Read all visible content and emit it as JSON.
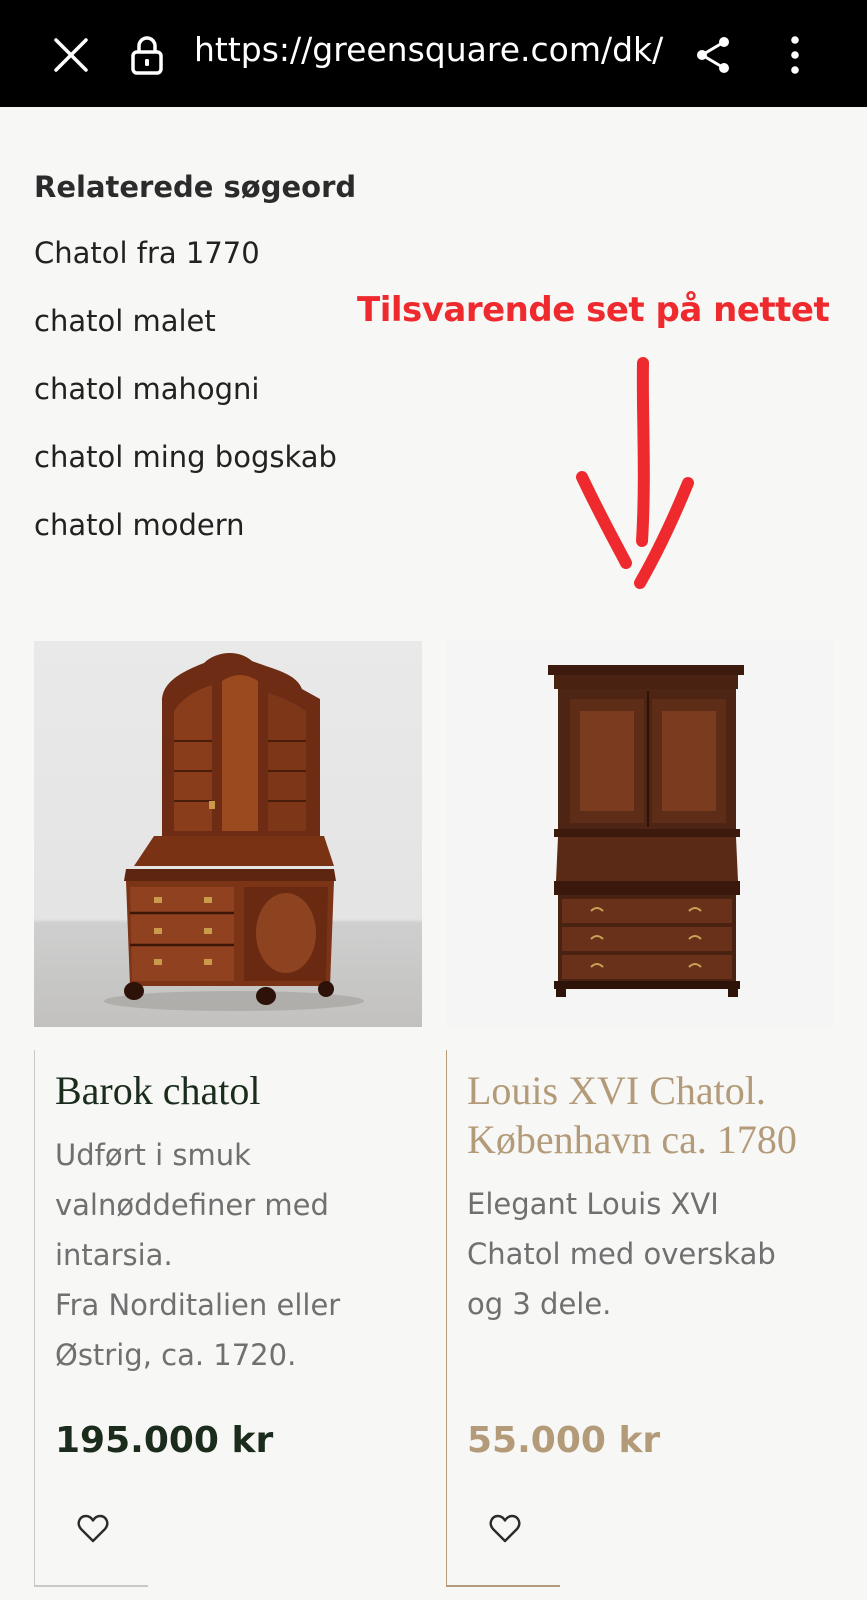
{
  "browser": {
    "url": "https://greensquare.com/dk/",
    "close_icon": "close-icon",
    "lock_icon": "lock-icon",
    "share_icon": "share-icon",
    "menu_icon": "more-vertical-icon"
  },
  "related": {
    "title": "Relaterede søgeord",
    "items": [
      "Chatol fra 1770",
      "chatol malet",
      "chatol mahogni",
      "chatol ming bogskab",
      "chatol modern"
    ]
  },
  "annotation": {
    "text": "Tilsvarende set på nettet",
    "color": "#ee2a2e"
  },
  "products": [
    {
      "title": "Barok chatol",
      "desc_lines": [
        "Udført i smuk",
        "valnøddefiner med",
        "intarsia.",
        "Fra Norditalien eller",
        "Østrig, ca. 1720."
      ],
      "price": "195.000 kr",
      "accent": "#1b2c1c"
    },
    {
      "title_lines": [
        "Louis XVI Chatol.",
        "København ca. 1780"
      ],
      "desc_lines": [
        "Elegant Louis XVI",
        "Chatol med overskab",
        "og 3 dele."
      ],
      "price": "55.000 kr",
      "accent": "#b39a78"
    }
  ]
}
